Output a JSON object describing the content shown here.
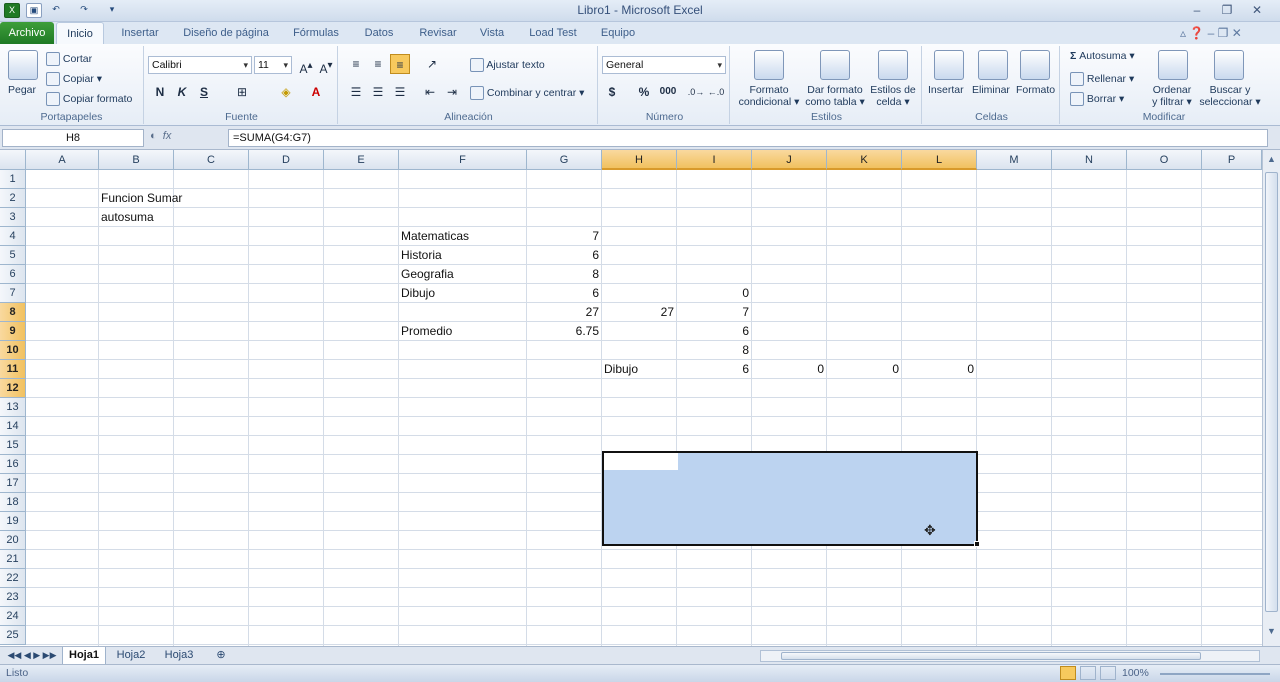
{
  "window": {
    "title": "Libro1 - Microsoft Excel"
  },
  "tabs": [
    "Archivo",
    "Inicio",
    "Insertar",
    "Diseño de página",
    "Fórmulas",
    "Datos",
    "Revisar",
    "Vista",
    "Load Test",
    "Equipo"
  ],
  "ribbon": {
    "portapapeles": {
      "paste": "Pegar",
      "cut": "Cortar",
      "copy": "Copiar",
      "format_painter": "Copiar formato",
      "label": "Portapapeles"
    },
    "fuente": {
      "font": "Calibri",
      "size": "11",
      "bold": "N",
      "italic": "K",
      "underline": "S",
      "label": "Fuente"
    },
    "alineacion": {
      "wrap": "Ajustar texto",
      "merge": "Combinar y centrar",
      "label": "Alineación"
    },
    "numero": {
      "format": "General",
      "currency": "$",
      "percent": "%",
      "thousands": "000",
      "label": "Número"
    },
    "estilos": {
      "cond1": "Formato",
      "cond2": "condicional",
      "table1": "Dar formato",
      "table2": "como tabla",
      "cell1": "Estilos de",
      "cell2": "celda",
      "label": "Estilos"
    },
    "celdas": {
      "insert": "Insertar",
      "delete": "Eliminar",
      "format": "Formato",
      "label": "Celdas"
    },
    "modificar": {
      "autosum": "Autosuma",
      "fill": "Rellenar",
      "clear": "Borrar",
      "sort1": "Ordenar",
      "sort2": "y filtrar",
      "find1": "Buscar y",
      "find2": "seleccionar",
      "label": "Modificar"
    }
  },
  "formula_bar": {
    "name_box": "H8",
    "fx": "fx",
    "formula": "=SUMA(G4:G7)"
  },
  "columns": [
    "A",
    "B",
    "C",
    "D",
    "E",
    "F",
    "G",
    "H",
    "I",
    "J",
    "K",
    "L",
    "M",
    "N",
    "O",
    "P"
  ],
  "rows": [
    "1",
    "2",
    "3",
    "4",
    "5",
    "6",
    "7",
    "8",
    "9",
    "10",
    "11",
    "12",
    "13",
    "14",
    "15",
    "16",
    "17",
    "18",
    "19",
    "20",
    "21",
    "22",
    "23",
    "24",
    "25"
  ],
  "cells": {
    "B2": "Funcion Sumar",
    "B3": "autosuma",
    "F4": "Matematicas",
    "G4": "7",
    "F5": "Historia",
    "G5": "6",
    "F6": "Geografia",
    "G6": "8",
    "F7": "Dibujo",
    "G7": "6",
    "I7": "0",
    "G8": "27",
    "H8": "27",
    "I8": "7",
    "F9": "Promedio",
    "G9": "6.75",
    "I9": "6",
    "I10": "8",
    "H11": "Dibujo",
    "I11": "6",
    "J11": "0",
    "K11": "0",
    "L11": "0"
  },
  "sheet_tabs": [
    "Hoja1",
    "Hoja2",
    "Hoja3"
  ],
  "status": {
    "mode": "Listo",
    "zoom": "100%"
  }
}
